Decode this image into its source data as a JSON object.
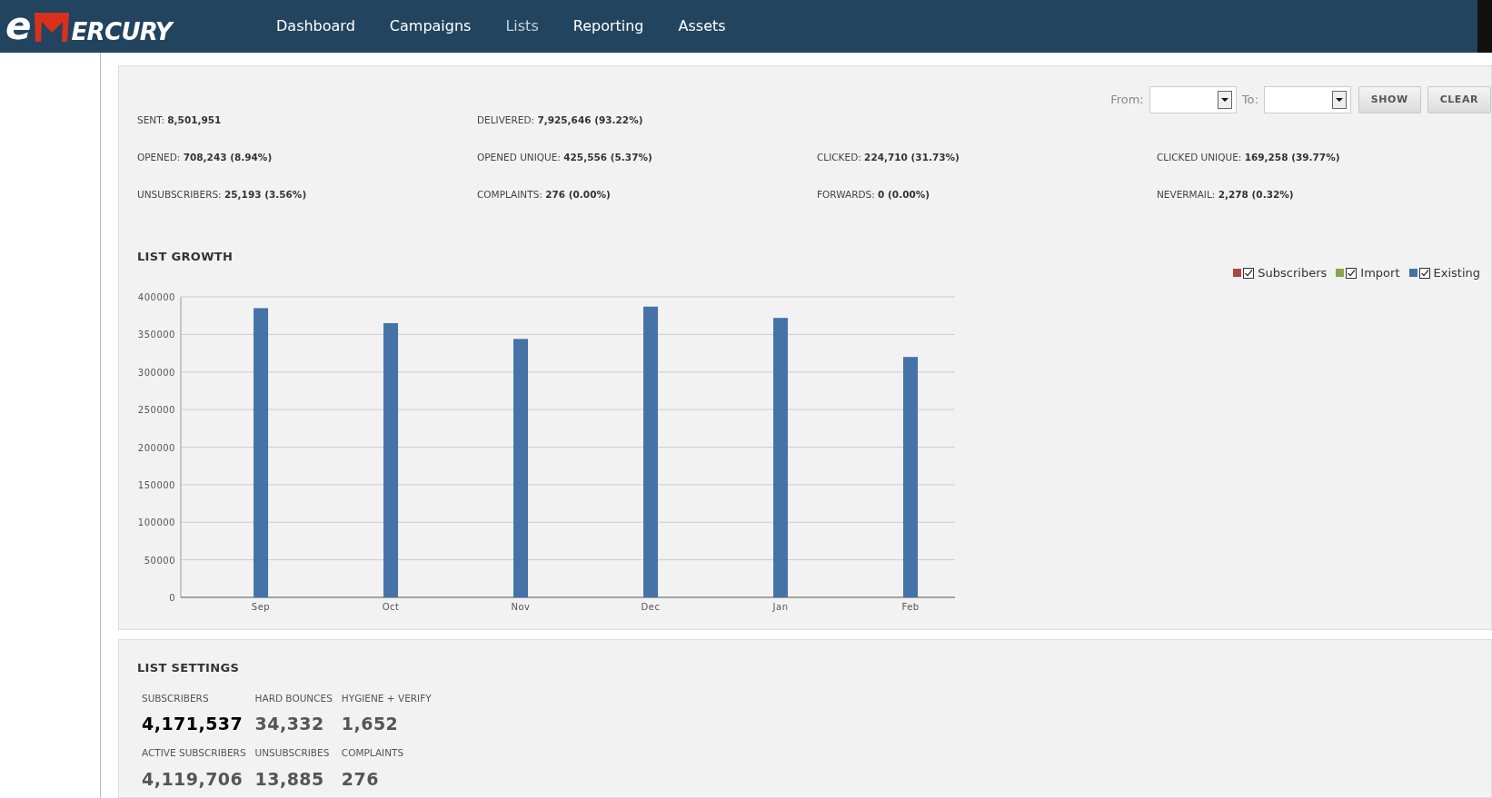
{
  "logo": {
    "prefix": "e",
    "suffix": "ERCURY"
  },
  "nav": [
    {
      "label": "Dashboard",
      "selected": false
    },
    {
      "label": "Campaigns",
      "selected": false
    },
    {
      "label": "Lists",
      "selected": true
    },
    {
      "label": "Reporting",
      "selected": false
    },
    {
      "label": "Assets",
      "selected": false
    }
  ],
  "filter": {
    "from_label": "From:",
    "to_label": "To:",
    "buttons": [
      "SHOW",
      "CLEAR"
    ]
  },
  "stats": [
    [
      {
        "label": "SENT:",
        "value": "8,501,951"
      },
      {
        "label": "DELIVERED:",
        "value": "7,925,646 (93.22%)"
      }
    ],
    [
      {
        "label": "OPENED:",
        "value": "708,243 (8.94%)"
      },
      {
        "label": "OPENED UNIQUE:",
        "value": "425,556 (5.37%)"
      },
      {
        "label": "CLICKED:",
        "value": "224,710 (31.73%)"
      },
      {
        "label": "CLICKED UNIQUE:",
        "value": "169,258 (39.77%)"
      }
    ],
    [
      {
        "label": "UNSUBSCRIBERS:",
        "value": "25,193 (3.56%)"
      },
      {
        "label": "COMPLAINTS:",
        "value": "276 (0.00%)"
      },
      {
        "label": "FORWARDS:",
        "value": "0 (0.00%)"
      },
      {
        "label": "NEVERMAIL:",
        "value": "2,278 (0.32%)"
      }
    ]
  ],
  "list_growth": {
    "title": "LIST GROWTH",
    "legend": [
      {
        "checked": true
      },
      {
        "checked": true
      },
      {
        "checked": true
      }
    ],
    "chart_data": {
      "type": "bar",
      "categories": [
        "Sep",
        "Oct",
        "Nov",
        "Dec",
        "Jan",
        "Feb"
      ],
      "series": [
        {
          "name": "Subscribers",
          "color": "#aa4643",
          "values": [
            null,
            null,
            null,
            null,
            null,
            null
          ]
        },
        {
          "name": "Import",
          "color": "#89a54e",
          "values": [
            null,
            null,
            null,
            null,
            null,
            null
          ]
        },
        {
          "name": "Existing",
          "color": "#4572a7",
          "values": [
            385000,
            365000,
            344000,
            387000,
            372000,
            320000
          ]
        }
      ],
      "ylim": [
        0,
        400000
      ],
      "yticks": [
        0,
        50000,
        100000,
        150000,
        200000,
        250000,
        300000,
        350000,
        400000
      ],
      "grid": true
    }
  },
  "list_settings": {
    "title": "LIST SETTINGS",
    "metrics": [
      {
        "label": "SUBSCRIBERS",
        "value": "4,171,537",
        "emphasized": true
      },
      {
        "label": "HARD BOUNCES",
        "value": "34,332",
        "emphasized": false
      },
      {
        "label": "HYGIENE + VERIFY",
        "value": "1,652",
        "emphasized": false
      },
      {
        "label": "ACTIVE SUBSCRIBERS",
        "value": "4,119,706",
        "emphasized": false
      },
      {
        "label": "UNSUBSCRIBES",
        "value": "13,885",
        "emphasized": false
      },
      {
        "label": "COMPLAINTS",
        "value": "276",
        "emphasized": false
      }
    ]
  }
}
